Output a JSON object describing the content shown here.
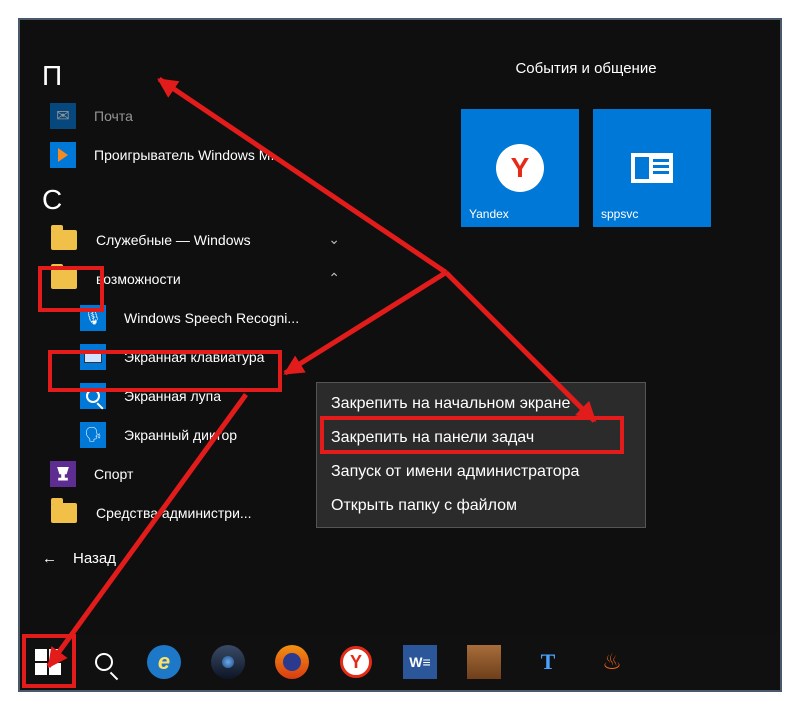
{
  "sections": {
    "p": "П",
    "c": "С"
  },
  "apps_p": [
    {
      "label": "Почта",
      "icon": "mail"
    },
    {
      "label": "Проигрыватель Windows M...",
      "icon": "wmp"
    }
  ],
  "apps_c": [
    {
      "label": "Служебные — Windows",
      "icon": "folder",
      "chevron": "⌄"
    },
    {
      "label": "возможности",
      "icon": "folder",
      "chevron": "⌃"
    },
    {
      "label": "Windows Speech Recogni...",
      "icon": "mic"
    },
    {
      "label": "Экранная клавиатура",
      "icon": "kbd"
    },
    {
      "label": "Экранная лупа",
      "icon": "mag"
    },
    {
      "label": "Экранный диктор",
      "icon": "narr"
    },
    {
      "label": "Спорт",
      "icon": "sport"
    },
    {
      "label": "Средства администри...",
      "icon": "folder",
      "chevron": "⌄"
    }
  ],
  "back_label": "Назад",
  "tiles": {
    "group_title": "События и общение",
    "items": [
      {
        "label": "Yandex",
        "icon": "Y"
      },
      {
        "label": "sppsvc",
        "icon": "news"
      }
    ]
  },
  "context_menu": [
    "Закрепить на начальном экране",
    "Закрепить на панели задач",
    "Запуск от имени администратора",
    "Открыть папку с файлом"
  ],
  "taskbar": {
    "buttons": [
      "start",
      "search",
      "ie",
      "srware",
      "firefox",
      "yandex",
      "word",
      "bricks",
      "tt",
      "flame"
    ]
  },
  "annotation": {
    "highlighted_item": "Экранная клавиатура",
    "highlighted_context": "Закрепить на панели задач"
  }
}
